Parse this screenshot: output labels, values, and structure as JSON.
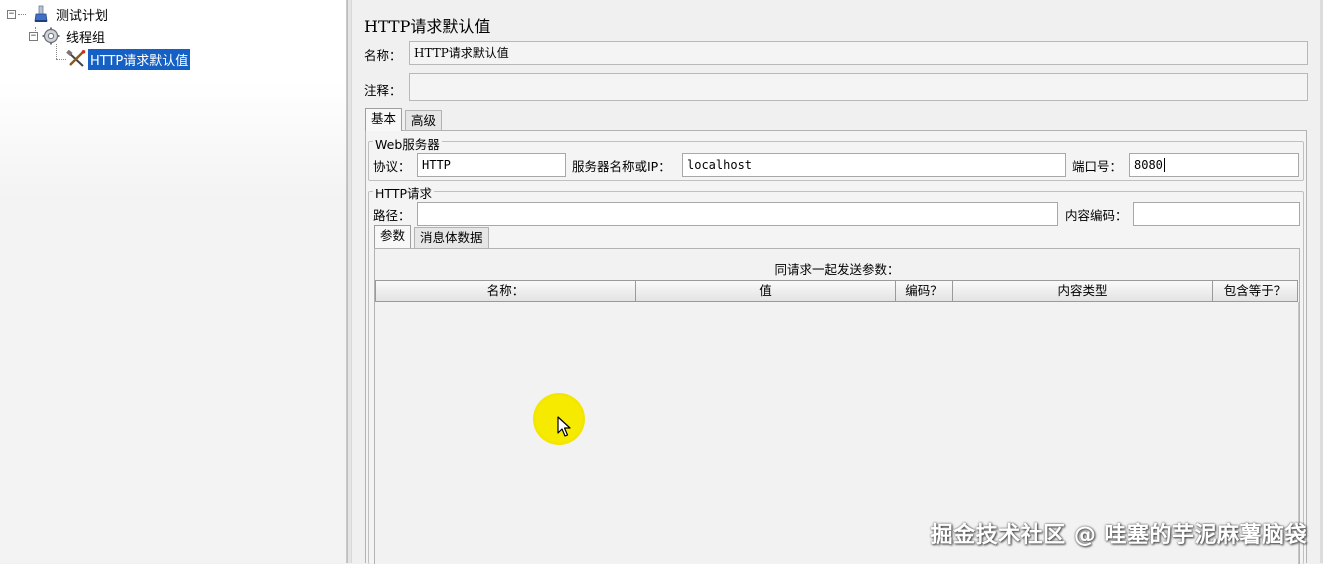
{
  "tree": {
    "items": [
      {
        "label": "测试计划",
        "toggle": "−",
        "icon": "test-plan-icon"
      },
      {
        "label": "线程组",
        "toggle": "−",
        "icon": "thread-group-icon"
      },
      {
        "label": "HTTP请求默认值",
        "icon": "config-tools-icon",
        "selected": true
      }
    ]
  },
  "panel": {
    "title": "HTTP请求默认值",
    "name_label": "名称：",
    "name_value": "HTTP请求默认值",
    "comment_label": "注释：",
    "comment_value": "",
    "tabs": [
      {
        "label": "基本",
        "active": true
      },
      {
        "label": "高级",
        "active": false
      }
    ],
    "web_server": {
      "title": "Web服务器",
      "protocol_label": "协议：",
      "protocol_value": "HTTP",
      "server_label": "服务器名称或IP：",
      "server_value": "localhost",
      "port_label": "端口号：",
      "port_value": "8080"
    },
    "http_request": {
      "title": "HTTP请求",
      "path_label": "路径：",
      "path_value": "",
      "encoding_label": "内容编码：",
      "encoding_value": "",
      "tabs": [
        {
          "label": "参数",
          "active": true
        },
        {
          "label": "消息体数据",
          "active": false
        }
      ],
      "params_caption": "同请求一起发送参数：",
      "columns": [
        "名称：",
        "值",
        "编码？",
        "内容类型",
        "包含等于？"
      ],
      "rows": []
    }
  },
  "watermark": "掘金技术社区 @ 哇塞的芋泥麻薯脑袋",
  "colors": {
    "selection": "#1560c4",
    "cursor_highlight": "#f6ea00"
  }
}
